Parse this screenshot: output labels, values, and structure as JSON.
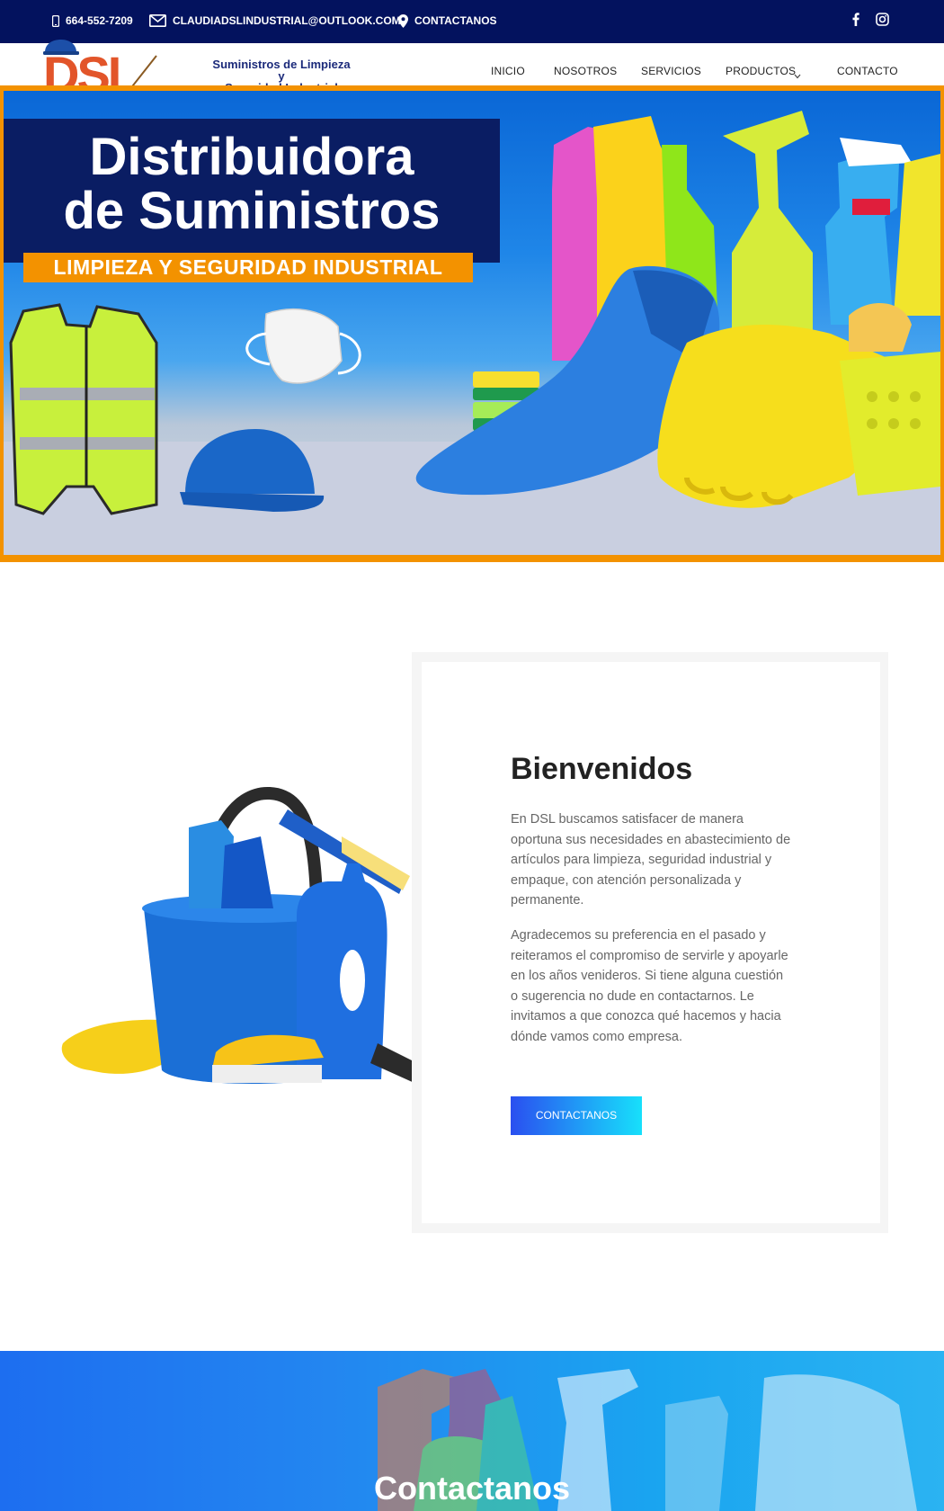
{
  "topbar": {
    "phone": "664-552-7209",
    "email": "CLAUDIADSLINDUSTRIAL@OUTLOOK.COM",
    "contact": "CONTACTANOS",
    "icons": [
      "phone-icon",
      "envelope-icon",
      "map-pin-icon",
      "facebook-icon",
      "instagram-icon"
    ]
  },
  "logo": {
    "mark": "DSL",
    "line1": "Suministros de Limpieza y",
    "line2": "Seguridad Industrial"
  },
  "nav": {
    "items": [
      "INICIO",
      "NOSOTROS",
      "SERVICIOS",
      "PRODUCTOS",
      "CONTACTO"
    ]
  },
  "hero": {
    "title_line1": "Distribuidora",
    "title_line2": "de Suministros",
    "subtitle": "LIMPIEZA Y SEGURIDAD INDUSTRIAL"
  },
  "welcome": {
    "title": "Bienvenidos",
    "p1": "En DSL buscamos satisfacer de manera oportuna sus necesidades en abastecimiento de artículos para limpieza, seguridad industrial y empaque, con atención personalizada y permanente.",
    "p2": "Agradecemos su preferencia en el pasado y reiteramos el compromiso de servirle y apoyarle en los años venideros. Si tiene alguna cuestión o sugerencia no dude en contactarnos. Le invitamos a que conozca qué hacemos y hacia dónde vamos como empresa.",
    "button": "CONTACTANOS"
  },
  "banner": {
    "title": "Contactanos"
  },
  "colors": {
    "topbar": "#03125e",
    "accent_orange": "#f39200",
    "title_box": "#0a1d63",
    "button_from": "#2a4ff0",
    "button_to": "#17e0fb"
  }
}
